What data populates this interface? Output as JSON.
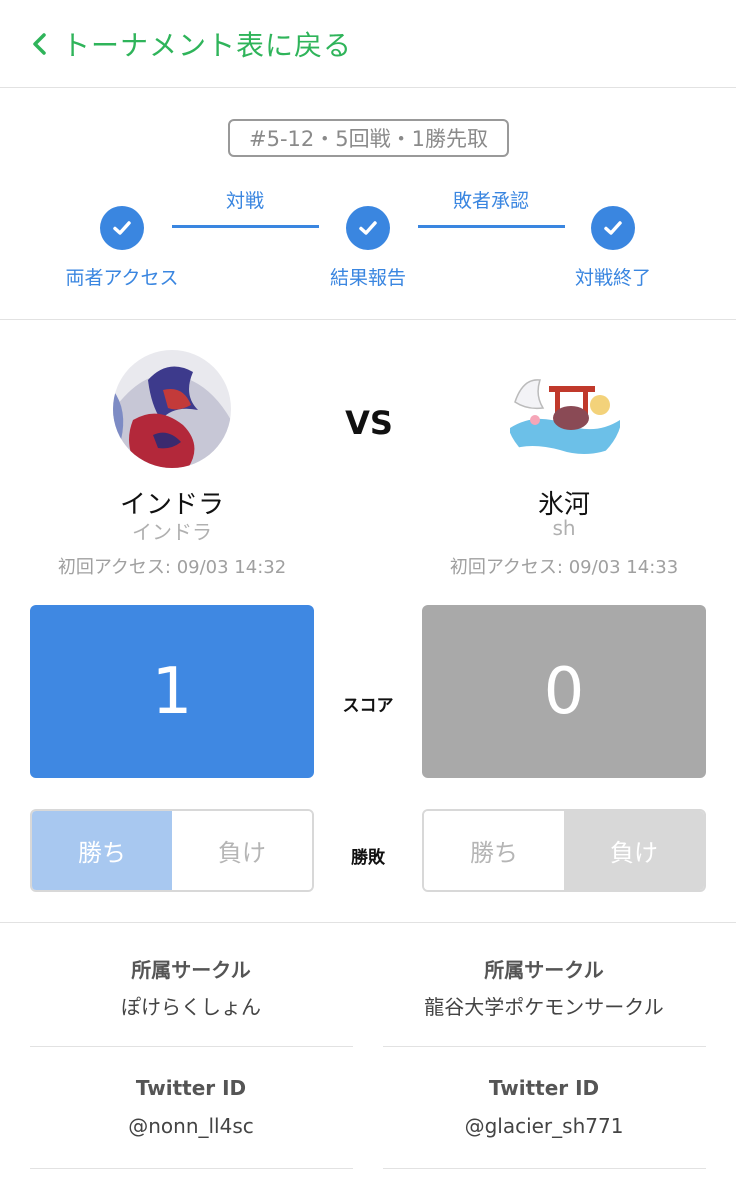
{
  "header": {
    "back_label": "トーナメント表に戻る"
  },
  "match": {
    "round_badge": "#5-12・5回戦・1勝先取",
    "steps": [
      "両者アクセス",
      "結果報告",
      "対戦終了"
    ],
    "step_links": [
      "対戦",
      "敗者承認"
    ]
  },
  "vs_label": "VS",
  "score_label": "スコア",
  "result_label": "勝敗",
  "players": [
    {
      "name": "インドラ",
      "sub": "インドラ",
      "first_access": "初回アクセス: 09/03 14:32",
      "score": "1",
      "win_label": "勝ち",
      "lose_label": "負け",
      "result": "win",
      "circle_label": "所属サークル",
      "circle": "ぽけらくしょん",
      "twitter_label": "Twitter ID",
      "twitter": "@nonn_ll4sc"
    },
    {
      "name": "氷河",
      "sub": "sh",
      "first_access": "初回アクセス: 09/03 14:33",
      "score": "0",
      "win_label": "勝ち",
      "lose_label": "負け",
      "result": "lose",
      "circle_label": "所属サークル",
      "circle": "龍谷大学ポケモンサークル",
      "twitter_label": "Twitter ID",
      "twitter": "@glacier_sh771"
    }
  ],
  "colors": {
    "accent_green": "#2fb45a",
    "accent_blue": "#3a86e0",
    "score_win": "#3f88e2",
    "score_lose": "#a9a9a9",
    "toggle_win": "#a8c8f0",
    "toggle_lose": "#d8d8d8"
  }
}
